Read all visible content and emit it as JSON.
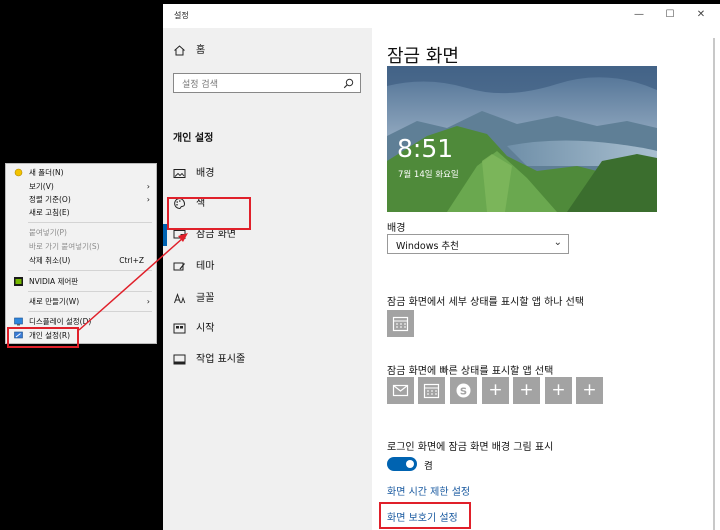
{
  "context_menu": {
    "items": [
      {
        "label": "새 폴더(N)",
        "icon": "folder-icon",
        "disabled": false
      },
      {
        "label": "보기(V)",
        "submenu": true,
        "disabled": false
      },
      {
        "label": "정렬 기준(O)",
        "submenu": true,
        "disabled": false
      },
      {
        "label": "새로 고침(E)",
        "disabled": false
      },
      {
        "label": "붙여넣기(P)",
        "disabled": true
      },
      {
        "label": "바로 가기 붙여넣기(S)",
        "disabled": true
      },
      {
        "label": "삭제 취소(U)",
        "shortcut": "Ctrl+Z",
        "disabled": false
      },
      {
        "label": "NVIDIA 제어판",
        "icon": "nvidia-icon",
        "disabled": false
      },
      {
        "label": "새로 만들기(W)",
        "submenu": true,
        "disabled": false
      },
      {
        "label": "디스플레이 설정(D)",
        "icon": "display-icon",
        "disabled": false
      },
      {
        "label": "개인 설정(R)",
        "icon": "personalize-icon",
        "disabled": false
      }
    ]
  },
  "window": {
    "title": "설정",
    "controls": {
      "minimize": "—",
      "maximize": "☐",
      "close": "✕"
    }
  },
  "nav": {
    "home": "홈",
    "search_placeholder": "설정 검색",
    "section_title": "개인 설정",
    "items": [
      {
        "label": "배경",
        "icon": "picture-icon"
      },
      {
        "label": "색",
        "icon": "palette-icon"
      },
      {
        "label": "잠금 화면",
        "icon": "lock-screen-icon",
        "selected": true
      },
      {
        "label": "테마",
        "icon": "brush-icon"
      },
      {
        "label": "글꼴",
        "icon": "font-icon"
      },
      {
        "label": "시작",
        "icon": "start-icon"
      },
      {
        "label": "작업 표시줄",
        "icon": "taskbar-icon"
      }
    ]
  },
  "main": {
    "title": "잠금 화면",
    "preview": {
      "time": "8:51",
      "date": "7월 14일 화요일"
    },
    "background_label": "배경",
    "background_value": "Windows 추천",
    "detailed_status_label": "잠금 화면에서 세부 상태를 표시할 앱 하나 선택",
    "quick_status_label": "잠금 화면에 빠른 상태를 표시할 앱 선택",
    "quick_status_apps": [
      "mail-icon",
      "calendar-icon",
      "skype-icon",
      "plus-icon",
      "plus-icon",
      "plus-icon",
      "plus-icon"
    ],
    "signin_bg_label": "로그인 화면에 잠금 화면 배경 그림 표시",
    "toggle_state": "켬",
    "link_timeout": "화면 시간 제한 설정",
    "link_screensaver": "화면 보호기 설정"
  },
  "colors": {
    "accent": "#0063b1",
    "highlight": "#e0202a",
    "link": "#1a5aa0"
  }
}
